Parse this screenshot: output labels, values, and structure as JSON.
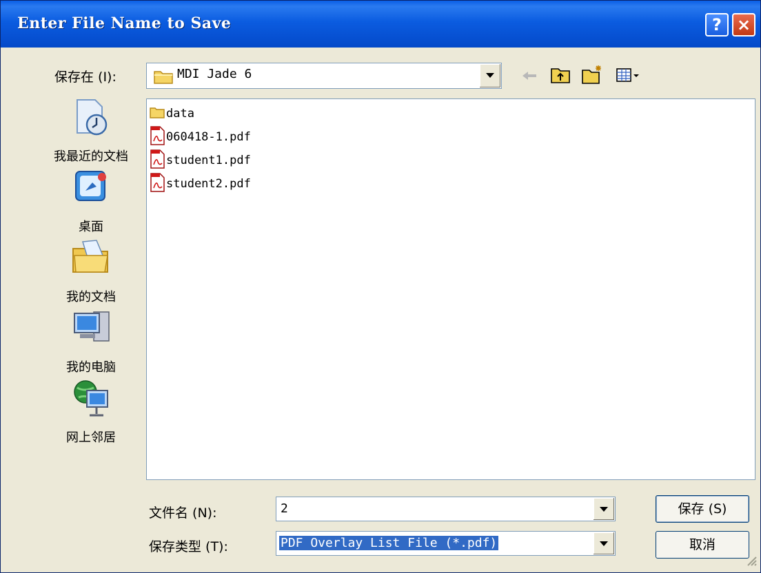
{
  "window": {
    "title": "Enter File Name to Save",
    "help_glyph": "?",
    "close_glyph": "×"
  },
  "location": {
    "label": "保存在 (I):",
    "value": "MDI Jade 6"
  },
  "places": [
    {
      "label": "我最近的文档",
      "icon": "recent-documents-icon"
    },
    {
      "label": "桌面",
      "icon": "desktop-icon"
    },
    {
      "label": "我的文档",
      "icon": "my-documents-icon"
    },
    {
      "label": "我的电脑",
      "icon": "my-computer-icon"
    },
    {
      "label": "网上邻居",
      "icon": "network-places-icon"
    }
  ],
  "files": [
    {
      "name": "data",
      "type": "folder"
    },
    {
      "name": "060418-1.pdf",
      "type": "pdf"
    },
    {
      "name": "student1.pdf",
      "type": "pdf"
    },
    {
      "name": "student2.pdf",
      "type": "pdf"
    }
  ],
  "filename": {
    "label": "文件名 (N):",
    "value": "2"
  },
  "filetype": {
    "label": "保存类型 (T):",
    "value": "PDF Overlay List File (*.pdf)"
  },
  "buttons": {
    "save": "保存 (S)",
    "cancel": "取消"
  },
  "colors": {
    "titlebar": "#0449c9",
    "selection": "#316ac5",
    "dialog_bg": "#ece9d8"
  }
}
